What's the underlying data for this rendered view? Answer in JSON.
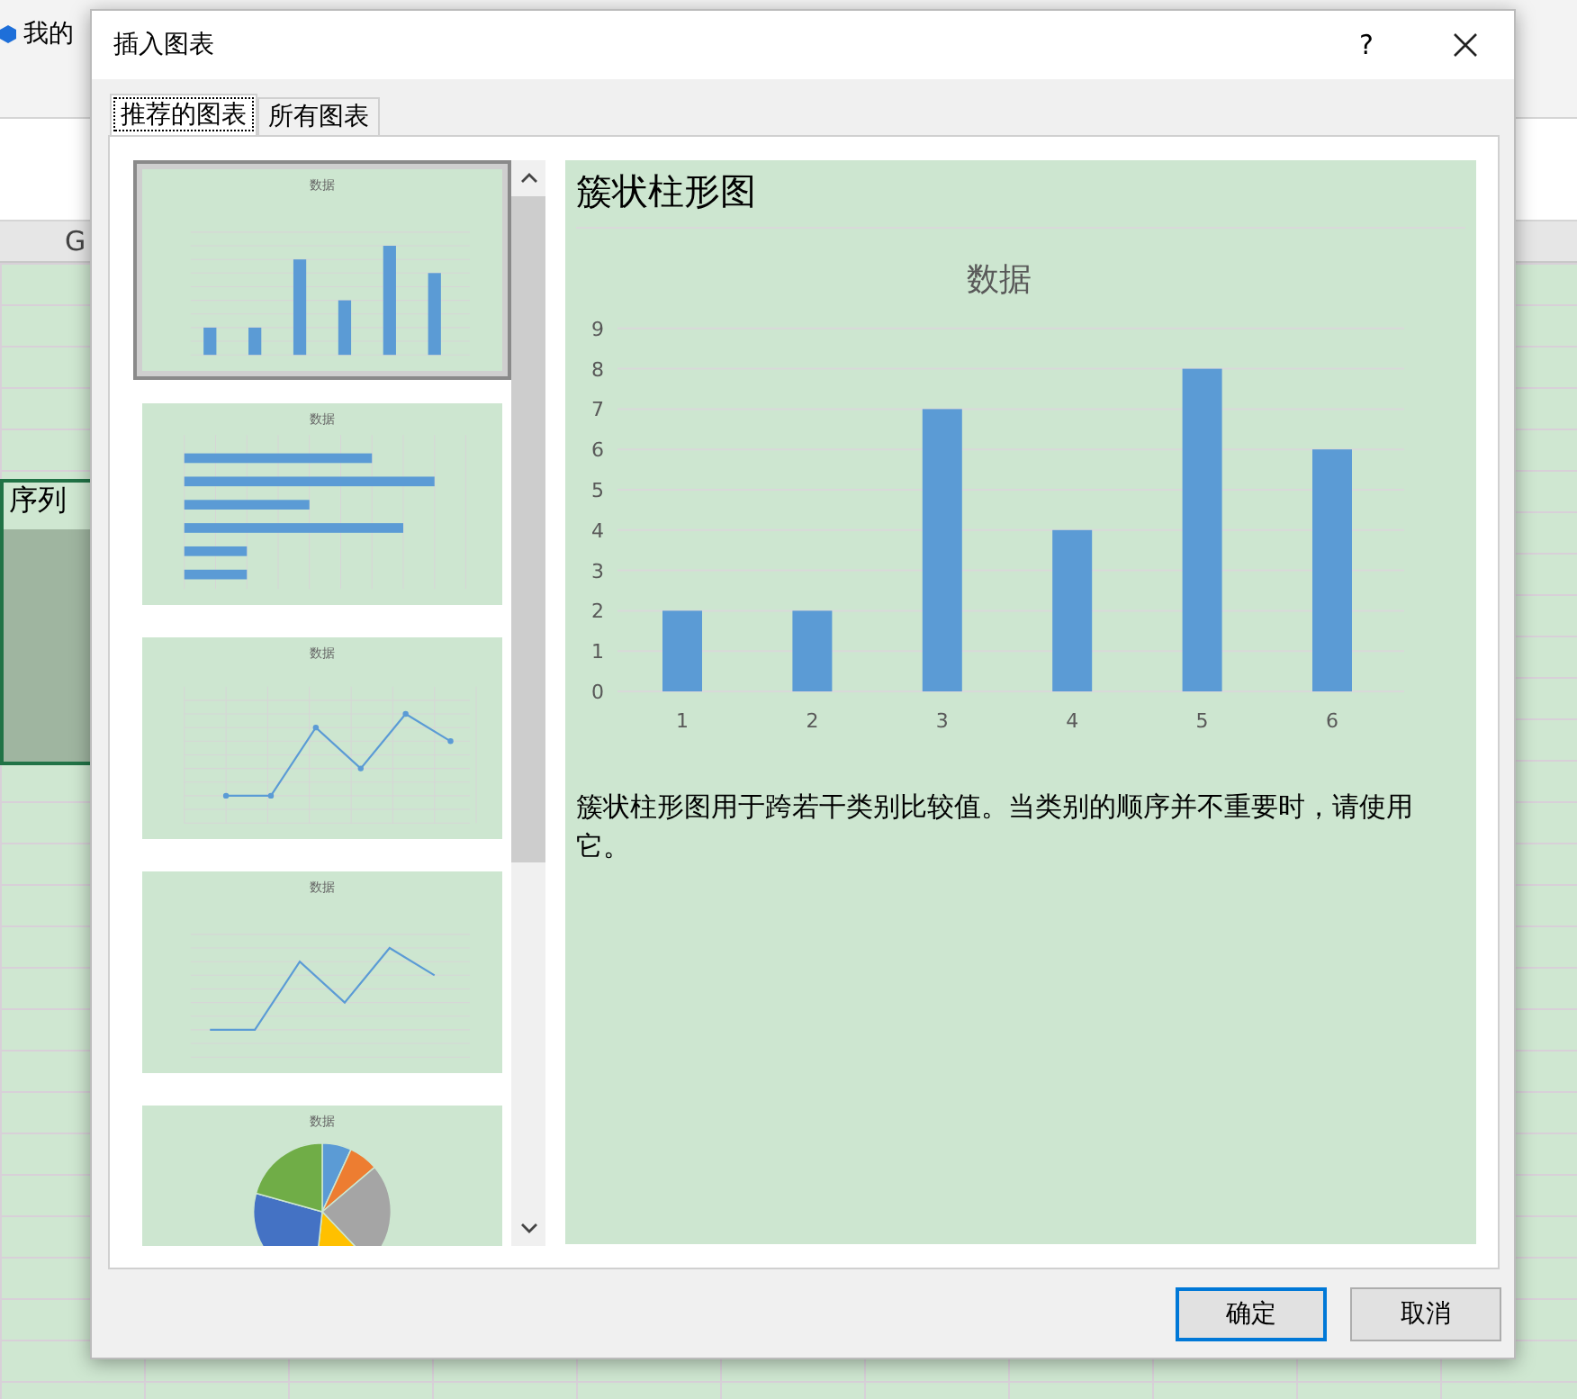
{
  "sheet": {
    "ribbon_label": "我的",
    "column_left": "G",
    "cell_text": "序列"
  },
  "dialog": {
    "title": "插入图表",
    "help": "?",
    "tabs": [
      {
        "label": "推荐的图表",
        "selected": true
      },
      {
        "label": "所有图表",
        "selected": false
      }
    ],
    "thumbnails": [
      {
        "kind": "column",
        "title": "数据",
        "selected": true
      },
      {
        "kind": "hbar",
        "title": "数据",
        "selected": false
      },
      {
        "kind": "markers",
        "title": "数据",
        "selected": false
      },
      {
        "kind": "line",
        "title": "数据",
        "selected": false
      },
      {
        "kind": "pie",
        "title": "数据",
        "selected": false
      }
    ],
    "preview": {
      "heading": "簇状柱形图",
      "chart_data": {
        "type": "bar",
        "title": "数据",
        "categories": [
          "1",
          "2",
          "3",
          "4",
          "5",
          "6"
        ],
        "yticks": [
          0,
          1,
          2,
          3,
          4,
          5,
          6,
          7,
          8,
          9
        ],
        "ylim": [
          0,
          9
        ],
        "grid": true,
        "series": [
          {
            "color": "#5b9bd5",
            "values": [
              2,
              2,
              7,
              4,
              8,
              6
            ]
          }
        ]
      },
      "description": "簇状柱形图用于跨若干类别比较值。当类别的顺序并不重要时，请使用它。"
    },
    "buttons": [
      {
        "label": "确定",
        "kind": "default"
      },
      {
        "label": "取消",
        "kind": "normal"
      }
    ]
  }
}
